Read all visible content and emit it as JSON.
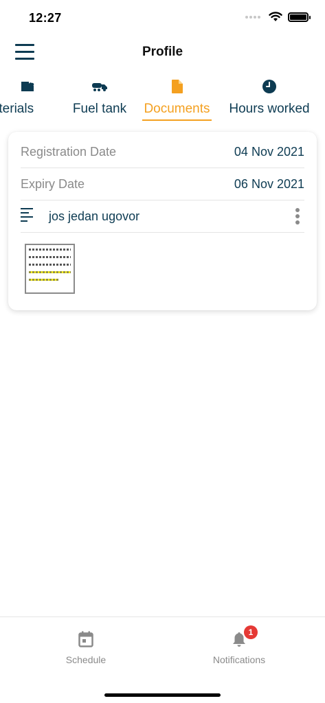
{
  "status_bar": {
    "time": "12:27"
  },
  "header": {
    "title": "Profile"
  },
  "tabs": [
    {
      "label": "Materials",
      "icon": "puzzle-icon"
    },
    {
      "label": "Fuel tank",
      "icon": "truck-icon"
    },
    {
      "label": "Documents",
      "icon": "document-icon",
      "active": true
    },
    {
      "label": "Hours worked",
      "icon": "clock-icon"
    }
  ],
  "document_card": {
    "registration_label": "Registration Date",
    "registration_value": "04 Nov 2021",
    "expiry_label": "Expiry Date",
    "expiry_value": "06 Nov 2021",
    "document_name": "jos jedan ugovor"
  },
  "bottom_nav": {
    "schedule_label": "Schedule",
    "notifications_label": "Notifications",
    "notifications_badge": "1"
  },
  "colors": {
    "primary": "#0d3b52",
    "accent": "#f4a020",
    "muted": "#8a8a8a",
    "badge": "#e53935"
  }
}
